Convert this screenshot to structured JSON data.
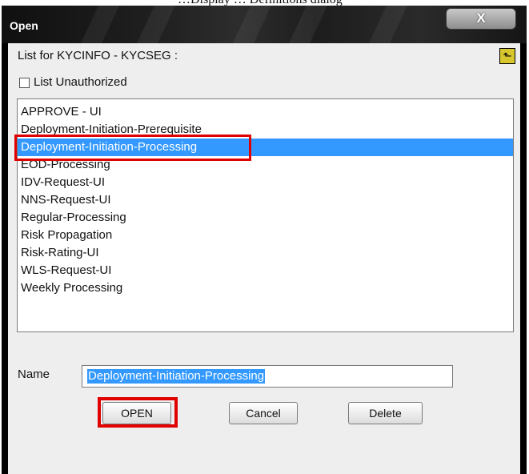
{
  "page_caption": "…Display … Definitions dialog",
  "dialog": {
    "title": "Open",
    "close_glyph": "X",
    "list_caption": "List for KYCINFO - KYCSEG :",
    "up_folder_icon": "folder-up-icon",
    "checkbox": {
      "label": "List Unauthorized",
      "checked": false
    },
    "list_items": [
      "APPROVE - UI",
      "Deployment-Initiation-Prerequisite",
      "Deployment-Initiation-Processing",
      "EOD-Processing",
      "IDV-Request-UI",
      "NNS-Request-UI",
      "Regular-Processing",
      "Risk Propagation",
      "Risk-Rating-UI",
      "WLS-Request-UI",
      "Weekly Processing"
    ],
    "selected_item": "Deployment-Initiation-Processing",
    "name_label": "Name",
    "name_value": "Deployment-Initiation-Processing",
    "buttons": {
      "open": "OPEN",
      "cancel": "Cancel",
      "delete": "Delete"
    }
  },
  "colors": {
    "selection": "#3399ff",
    "highlight_box": "#e00000",
    "titlebar": "#1a1a1a",
    "client_bg": "#eeeeee"
  }
}
